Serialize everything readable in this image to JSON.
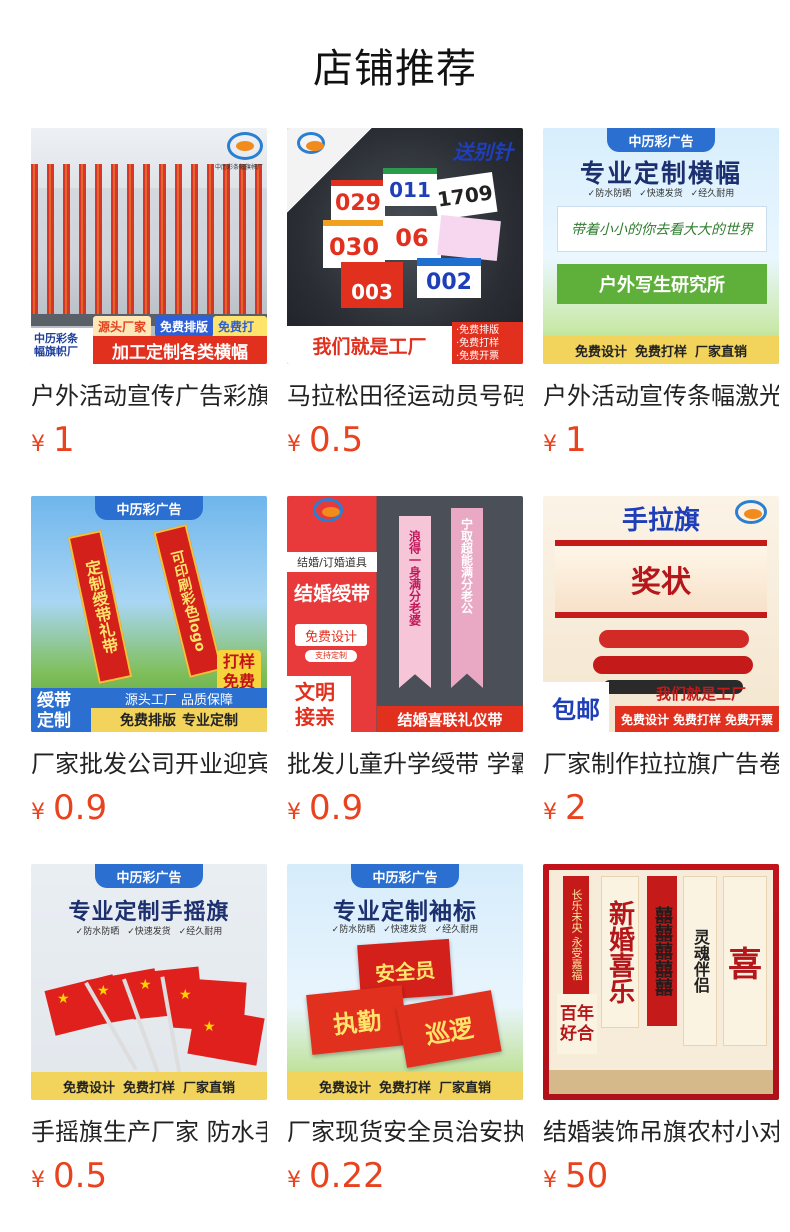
{
  "section": {
    "title": "店铺推荐"
  },
  "currency": "¥",
  "products": [
    {
      "title": "户外活动宣传广告彩旗定做",
      "price": "1",
      "thumb": {
        "brand": "中历彩条幅旗帜厂",
        "tags": [
          "源头厂家",
          "免费排版",
          "免费打样"
        ],
        "banner_text": "加工定制各类横幅"
      }
    },
    {
      "title": "马拉松田径运动员号码布",
      "price": "0.5",
      "thumb": {
        "top_text": "送别针",
        "numbers": [
          "029",
          "011",
          "1709",
          "030",
          "06",
          "003",
          "002"
        ],
        "bottom_text": "我们就是工厂",
        "perks": [
          "·免费排版",
          "·免费打样",
          "·免费开票"
        ]
      }
    },
    {
      "title": "户外活动宣传条幅激光横幅",
      "price": "1",
      "thumb": {
        "brand": "中历彩广告",
        "headline": "专业定制横幅",
        "features": [
          "✓防水防晒",
          "✓快速发货",
          "✓经久耐用"
        ],
        "banner1": "带着小小的你去看大大的世界",
        "banner2": "户外写生研究所",
        "bottom": [
          "免费设计",
          "免费打样",
          "厂家直销"
        ]
      }
    },
    {
      "title": "厂家批发公司开业迎宾绶带",
      "price": "0.9",
      "thumb": {
        "brand": "中历彩广告",
        "sash1": "定制绶带礼带",
        "sash2": "可印刷彩色logo",
        "badge": "打样免费",
        "corner": "绶带定制",
        "strip": "源头工厂 品质保障",
        "bottom": [
          "免费排版",
          "专业定制"
        ]
      }
    },
    {
      "title": "批发儿童升学绶带 学霸",
      "price": "0.9",
      "thumb": {
        "tag": "结婚/订婚道具",
        "headline": "结婚绶带",
        "button": "免费设计",
        "sub": "支持定制",
        "sash1": "浪得一身满分老婆",
        "sash2": "宁取超能满分老公",
        "corner": "文明接亲",
        "bottom": "结婚喜联礼仪带"
      }
    },
    {
      "title": "厂家制作拉拉旗广告卷轴",
      "price": "2",
      "thumb": {
        "headline": "手拉旗",
        "scroll_text": "奖状",
        "corner": "包邮",
        "bottom_text": "我们就是工厂",
        "bottom": [
          "免费设计",
          "免费打样",
          "免费开票"
        ]
      }
    },
    {
      "title": "手摇旗生产厂家 防水手摇旗",
      "price": "0.5",
      "thumb": {
        "brand": "中历彩广告",
        "headline": "专业定制手摇旗",
        "features": [
          "✓防水防晒",
          "✓快速发货",
          "✓经久耐用"
        ],
        "bottom": [
          "免费设计",
          "免费打样",
          "厂家直销"
        ]
      }
    },
    {
      "title": "厂家现货安全员治安执勤",
      "price": "0.22",
      "thumb": {
        "brand": "中历彩广告",
        "headline": "专业定制袖标",
        "features": [
          "✓防水防晒",
          "✓快速发货",
          "✓经久耐用"
        ],
        "bands": [
          "安全员",
          "执勤",
          "巡逻"
        ],
        "bottom": [
          "免费设计",
          "免费打样",
          "厂家直销"
        ]
      }
    },
    {
      "title": "结婚装饰吊旗农村小对联",
      "price": "50",
      "thumb": {
        "scrolls": [
          "长乐未央 永受嘉福",
          "新婚喜乐",
          "囍囍囍囍囍",
          "灵魂伴侣",
          "喜",
          "百年好合"
        ]
      }
    }
  ]
}
